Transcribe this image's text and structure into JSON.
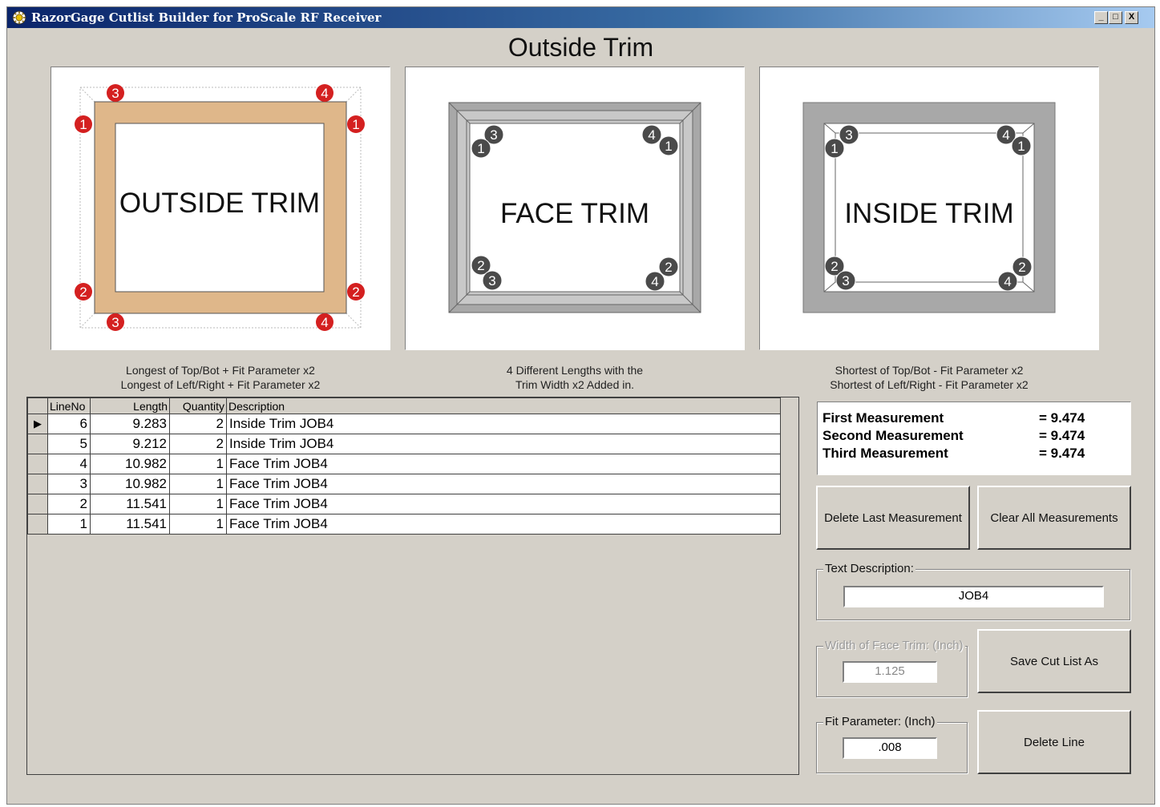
{
  "window": {
    "title": "RazorGage Cutlist Builder for ProScale RF Receiver",
    "min_label": "_",
    "max_label": "□",
    "close_label": "X"
  },
  "heading": "Outside Trim",
  "diagrams": [
    {
      "label": "OUTSIDE TRIM",
      "caption": "Longest of Top/Bot + Fit Parameter x2\nLongest of Left/Right + Fit Parameter x2"
    },
    {
      "label": "FACE TRIM",
      "caption": "4 Different Lengths with the\nTrim Width x2  Added in."
    },
    {
      "label": "INSIDE TRIM",
      "caption": "Shortest of Top/Bot - Fit Parameter x2\nShortest of Left/Right - Fit Parameter x2"
    }
  ],
  "marker_colors": {
    "outside": "#d42020",
    "inner": "#4a4a4a",
    "wood": "#dfb78a",
    "frame": "#a8a8a8"
  },
  "grid": {
    "columns": [
      "LineNo",
      "Length",
      "Quantity",
      "Description"
    ],
    "current_row_marker": "▶",
    "rows": [
      {
        "line": "6",
        "length": "9.283",
        "qty": "2",
        "desc": "Inside Trim  JOB4"
      },
      {
        "line": "5",
        "length": "9.212",
        "qty": "2",
        "desc": "Inside Trim  JOB4"
      },
      {
        "line": "4",
        "length": "10.982",
        "qty": "1",
        "desc": "Face Trim  JOB4"
      },
      {
        "line": "3",
        "length": "10.982",
        "qty": "1",
        "desc": "Face Trim  JOB4"
      },
      {
        "line": "2",
        "length": "11.541",
        "qty": "1",
        "desc": "Face Trim  JOB4"
      },
      {
        "line": "1",
        "length": "11.541",
        "qty": "1",
        "desc": "Face Trim  JOB4"
      }
    ]
  },
  "measurements": [
    {
      "label": "First Measurement",
      "value": "= 9.474"
    },
    {
      "label": "Second Measurement",
      "value": "= 9.474"
    },
    {
      "label": "Third Measurement",
      "value": "= 9.474"
    }
  ],
  "buttons": {
    "delete_last": "Delete Last Measurement",
    "clear_all": "Clear All Measurements",
    "save_cut_list": "Save Cut List As",
    "delete_line": "Delete Line"
  },
  "text_description": {
    "label": "Text Description:",
    "value": "JOB4"
  },
  "face_width": {
    "label": "Width of Face Trim: (Inch)",
    "value": "1.125"
  },
  "fit_parameter": {
    "label": "Fit Parameter: (Inch)",
    "value": ".008"
  }
}
